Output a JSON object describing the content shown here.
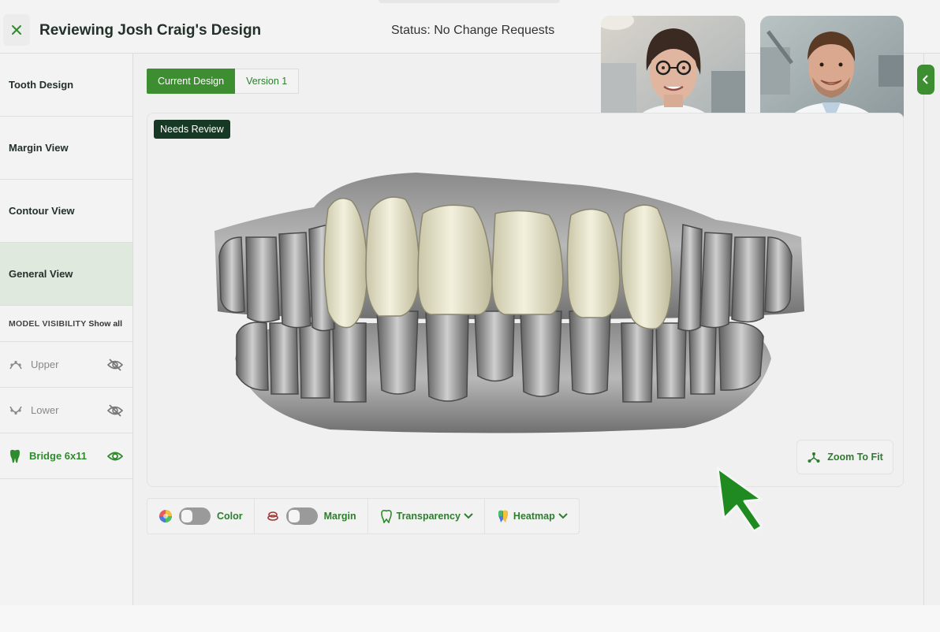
{
  "header": {
    "title": "Reviewing Josh Craig's Design",
    "status": "Status: No Change Requests"
  },
  "sidebar": {
    "items": [
      {
        "label": "Tooth Design"
      },
      {
        "label": "Margin View"
      },
      {
        "label": "Contour View"
      },
      {
        "label": "General View",
        "active": true
      }
    ],
    "model_visibility": {
      "title": "MODEL VISIBILITY",
      "show_all": "Show all",
      "rows": [
        {
          "label": "Upper",
          "icon": "upper-arch-icon",
          "visible": false
        },
        {
          "label": "Lower",
          "icon": "lower-arch-icon",
          "visible": false
        },
        {
          "label": "Bridge 6x11",
          "icon": "tooth-icon",
          "visible": true
        }
      ]
    }
  },
  "tabs": [
    {
      "label": "Current Design",
      "active": true
    },
    {
      "label": "Version 1",
      "active": false
    }
  ],
  "viewer": {
    "badge": "Needs Review",
    "zoom_label": "Zoom To Fit"
  },
  "toolbar": {
    "color_label": "Color",
    "margin_label": "Margin",
    "transparency_label": "Transparency",
    "heatmap_label": "Heatmap"
  },
  "colors": {
    "accent": "#3d8e31",
    "badge_bg": "#173824",
    "active_item_bg": "#dfe9de"
  }
}
